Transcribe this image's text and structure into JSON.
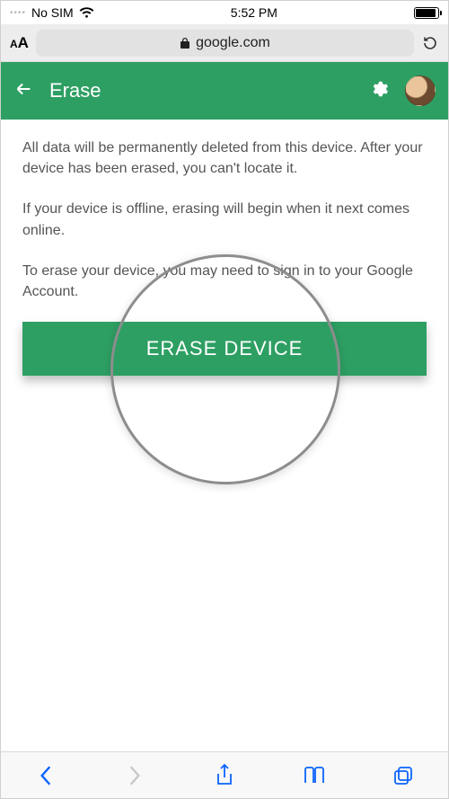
{
  "status": {
    "carrier": "No SIM",
    "time": "5:52 PM"
  },
  "urlbar": {
    "aa_small": "A",
    "aa_big": "A",
    "domain": "google.com"
  },
  "header": {
    "title": "Erase"
  },
  "content": {
    "p1": "All data will be permanently deleted from this device. After your device has been erased, you can't locate it.",
    "p2": "If your device is offline, erasing will begin when it next comes online.",
    "p3": "To erase your device, you may need to sign in to your Google Account.",
    "button": "ERASE DEVICE"
  }
}
